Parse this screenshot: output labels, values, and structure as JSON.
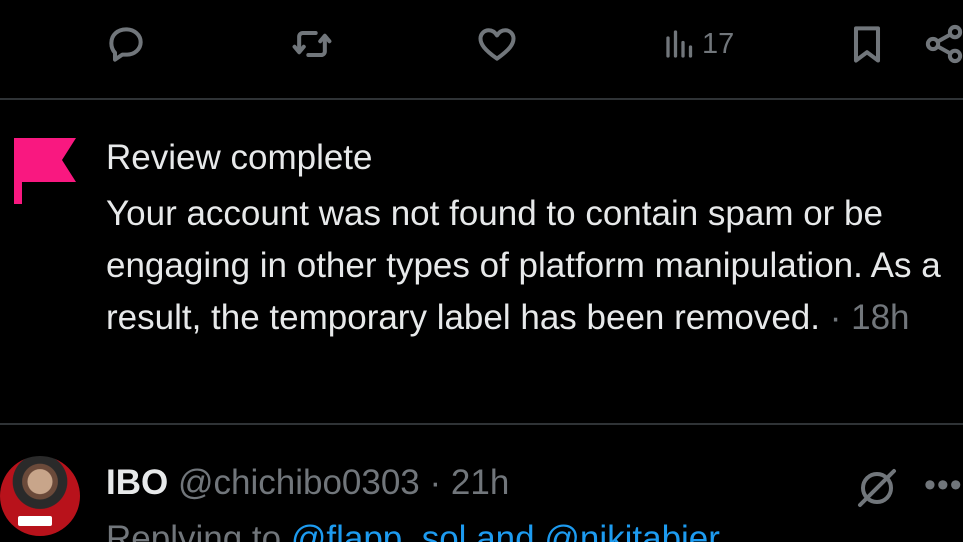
{
  "action_bar": {
    "views_count": "17"
  },
  "notice": {
    "title": "Review complete",
    "body": "Your account was not found to contain spam or be engaging in other types of platform manipulation. As a result, the temporary label has been removed.",
    "separator": " · ",
    "time": "18h",
    "flag_color": "#f91880"
  },
  "reply": {
    "name": "IBO",
    "handle": "@chichibo0303",
    "separator": " · ",
    "time": "21h",
    "replying_prefix": "Replying to ",
    "mention_1": "@flapp_sol",
    "conjunction": " and ",
    "mention_2": "@nikitabier"
  },
  "colors": {
    "background": "#000000",
    "text": "#e7e9ea",
    "muted": "#71767b",
    "link": "#1d9bf0",
    "divider": "#2f3336"
  }
}
